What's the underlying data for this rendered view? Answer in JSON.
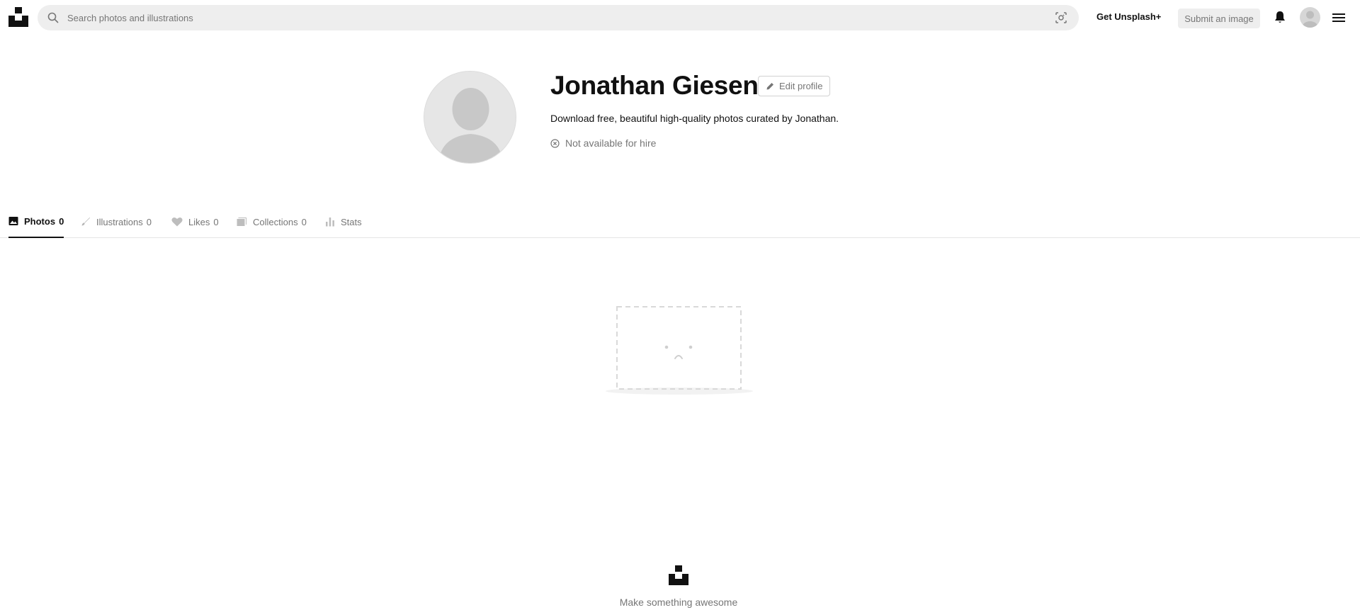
{
  "header": {
    "search_placeholder": "Search photos and illustrations",
    "get_plus": "Get Unsplash+",
    "submit": "Submit an image"
  },
  "profile": {
    "name": "Jonathan Giesen",
    "edit_label": "Edit profile",
    "bio": "Download free, beautiful high-quality photos curated by Jonathan.",
    "hire_status": "Not available for hire"
  },
  "tabs": [
    {
      "label": "Photos",
      "count": "0",
      "icon": "image-icon",
      "active": true
    },
    {
      "label": "Illustrations",
      "count": "0",
      "icon": "brush-icon",
      "active": false
    },
    {
      "label": "Likes",
      "count": "0",
      "icon": "heart-icon",
      "active": false
    },
    {
      "label": "Collections",
      "count": "0",
      "icon": "collection-icon",
      "active": false
    },
    {
      "label": "Stats",
      "count": "",
      "icon": "bar-chart-icon",
      "active": false
    }
  ],
  "footer": {
    "tagline": "Make something awesome"
  },
  "colors": {
    "text": "#111111",
    "muted": "#767676",
    "search_bg": "#eeeeee"
  }
}
